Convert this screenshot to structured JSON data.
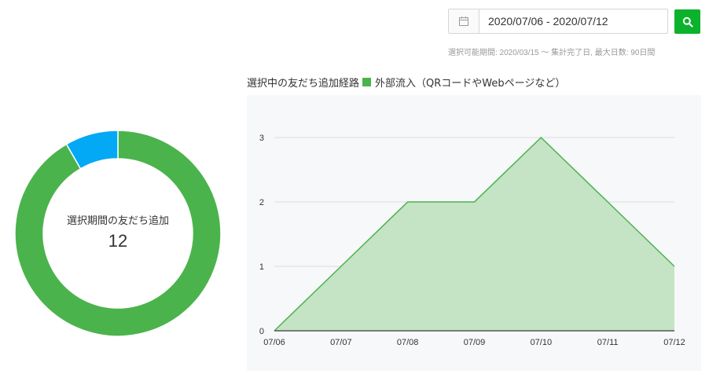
{
  "date_range": {
    "value": "2020/07/06 - 2020/07/12",
    "note": "選択可能期間: 2020/03/15 〜 集計完了日, 最大日数: 90日間"
  },
  "summary": {
    "label": "選択期間の友だち追加",
    "value": "12"
  },
  "colors": {
    "green": "#4bb34b",
    "blue": "#03a9f4",
    "fill": "#c5e3c5",
    "search_button": "#0bb22b"
  },
  "chart_data": [
    {
      "type": "pie",
      "style": "donut",
      "slices": [
        {
          "label": "外部流入（QRコードやWebページなど）",
          "value": 11,
          "color": "#4bb34b"
        },
        {
          "label": "",
          "value": 1,
          "color": "#03a9f4"
        }
      ]
    },
    {
      "type": "area",
      "title": "選択中の友だち追加経路",
      "series": [
        {
          "name": "外部流入（QRコードやWebページなど）",
          "values": [
            0,
            1,
            2,
            2,
            3,
            2,
            1
          ]
        }
      ],
      "categories": [
        "07/06",
        "07/07",
        "07/08",
        "07/09",
        "07/10",
        "07/11",
        "07/12"
      ],
      "yticks": [
        0,
        1,
        2,
        3
      ],
      "ylim": [
        0,
        3
      ],
      "grid": true
    }
  ]
}
